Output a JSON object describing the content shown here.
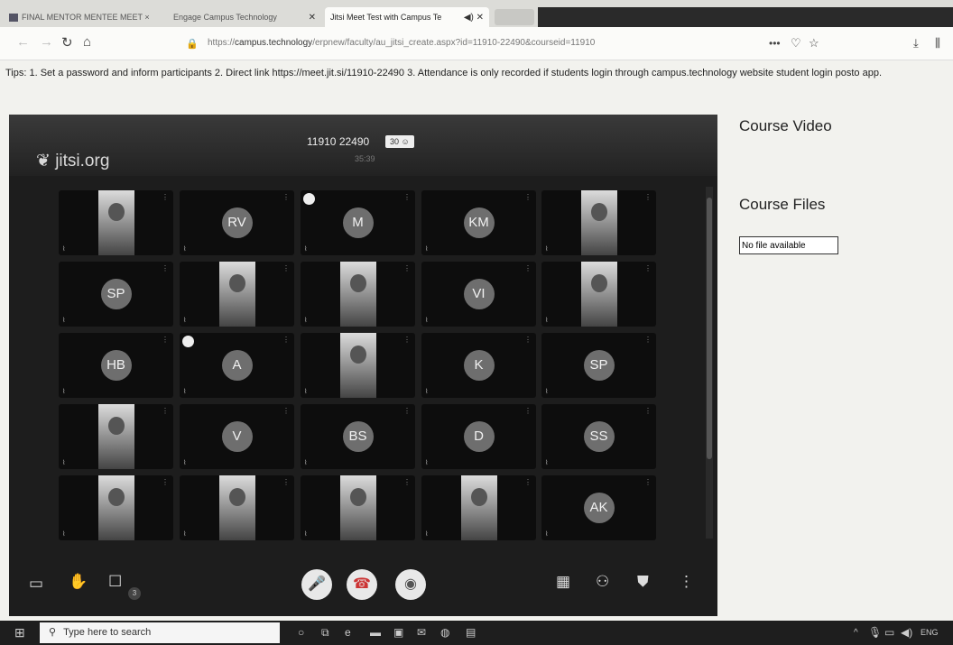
{
  "browser": {
    "tabs": [
      {
        "label": "FINAL MENTOR MENTEE MEET ×"
      },
      {
        "label": "Engage Campus Technology"
      },
      {
        "label": "Jitsi Meet Test with Campus Te"
      }
    ],
    "url_prefix": "https://",
    "url_host": "campus.technology",
    "url_path": "/erpnew/faculty/au_jitsi_create.aspx?id=11910-22490&courseid=11910"
  },
  "tips": "Tips: 1. Set a password and inform participants 2. Direct link https://meet.jit.si/11910-22490 3. Attendance is only recorded if students login through campus.technology website student login posto app.",
  "meeting": {
    "logo": "jitsi.org",
    "room_name": "11910 22490",
    "participant_count": "30",
    "timer": "35:39",
    "participants": [
      {
        "initials": "",
        "video": true
      },
      {
        "initials": "RV",
        "video": false
      },
      {
        "initials": "M",
        "video": false
      },
      {
        "initials": "KM",
        "video": false
      },
      {
        "initials": "",
        "video": true
      },
      {
        "initials": "SP",
        "video": false
      },
      {
        "initials": "",
        "video": true
      },
      {
        "initials": "",
        "video": true
      },
      {
        "initials": "VI",
        "video": false
      },
      {
        "initials": "",
        "video": true
      },
      {
        "initials": "HB",
        "video": false
      },
      {
        "initials": "A",
        "video": false
      },
      {
        "initials": "",
        "video": true
      },
      {
        "initials": "K",
        "video": false
      },
      {
        "initials": "SP",
        "video": false
      },
      {
        "initials": "",
        "video": true
      },
      {
        "initials": "V",
        "video": false
      },
      {
        "initials": "BS",
        "video": false
      },
      {
        "initials": "D",
        "video": false
      },
      {
        "initials": "SS",
        "video": false
      },
      {
        "initials": "",
        "video": true
      },
      {
        "initials": "",
        "video": true
      },
      {
        "initials": "",
        "video": true
      },
      {
        "initials": "",
        "video": true
      },
      {
        "initials": "AK",
        "video": false
      }
    ],
    "chat_badge": "3"
  },
  "side": {
    "course_video": "Course Video",
    "course_files": "Course Files",
    "no_file": "No file available"
  },
  "taskbar": {
    "search_placeholder": "Type here to search",
    "lang": "ENG"
  }
}
